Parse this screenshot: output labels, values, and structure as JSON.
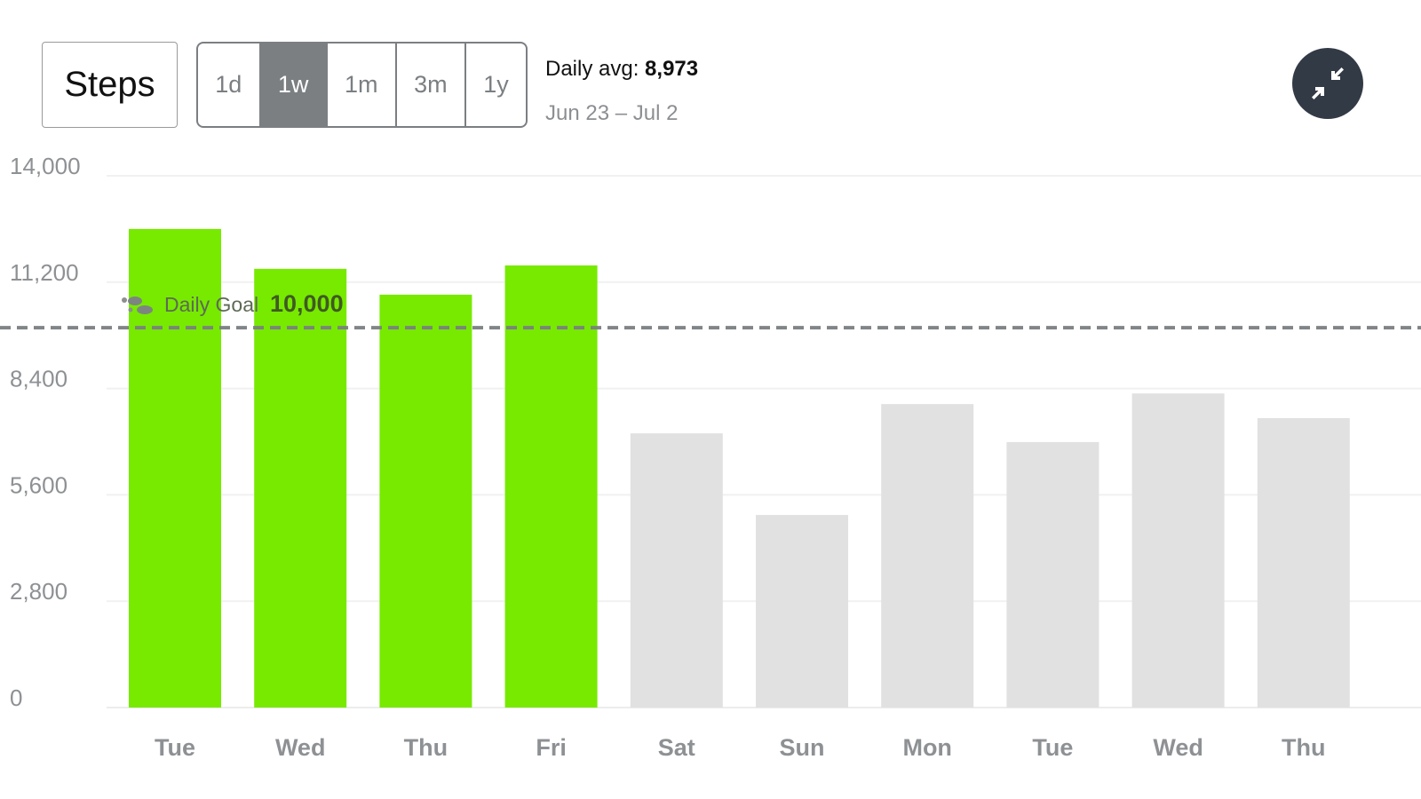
{
  "header": {
    "metric_label": "Steps",
    "ranges": [
      {
        "label": "1d",
        "active": false
      },
      {
        "label": "1w",
        "active": true
      },
      {
        "label": "1m",
        "active": false
      },
      {
        "label": "3m",
        "active": false
      },
      {
        "label": "1y",
        "active": false
      }
    ],
    "avg_label": "Daily avg: ",
    "avg_value": "8,973",
    "date_range": "Jun 23 – Jul 2",
    "collapse_icon": "collapse-arrows-icon"
  },
  "colors": {
    "goal_met": "#77ea00",
    "goal_missed": "#e1e1e1",
    "active_range": "#7b7f82",
    "collapse_button": "#323a46"
  },
  "chart_data": {
    "type": "bar",
    "title": "Steps",
    "xlabel": "",
    "ylabel": "",
    "ylim": [
      0,
      14000
    ],
    "yticks": [
      0,
      2800,
      5600,
      8400,
      11200,
      14000
    ],
    "ytick_labels": [
      "0",
      "2,800",
      "5,600",
      "8,400",
      "11,200",
      "14,000"
    ],
    "grid": true,
    "categories": [
      "Tue",
      "Wed",
      "Thu",
      "Fri",
      "Sat",
      "Sun",
      "Mon",
      "Tue",
      "Wed",
      "Thu"
    ],
    "values": [
      12600,
      11550,
      10870,
      11640,
      7220,
      5070,
      7990,
      6990,
      8270,
      7620
    ],
    "goal": {
      "label": "Daily Goal",
      "value": 10000,
      "value_label": "10,000",
      "icon": "footsteps-icon"
    }
  }
}
